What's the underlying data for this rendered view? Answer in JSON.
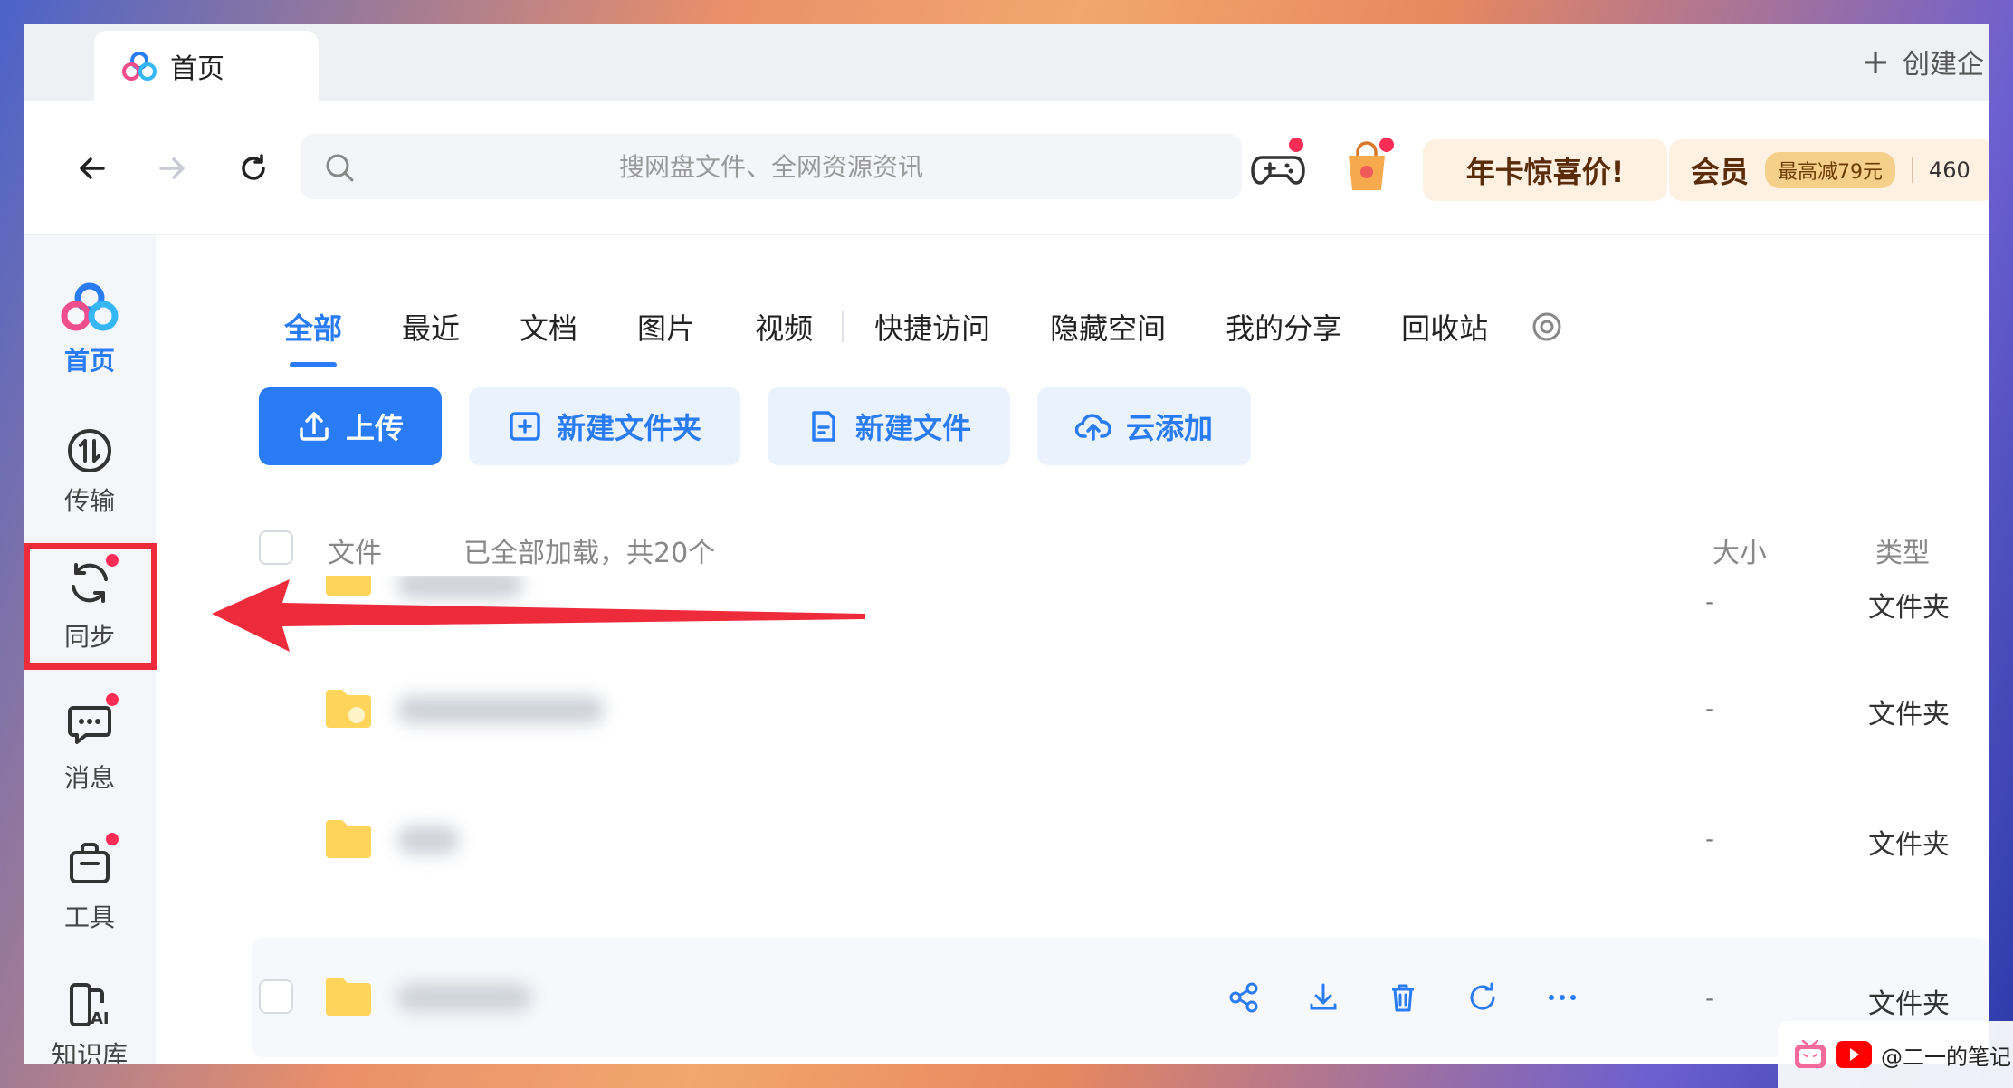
{
  "browser": {
    "tab_title": "首页",
    "new_tab_label": "创建企"
  },
  "toolbar": {
    "search_placeholder": "搜网盘文件、全网资源资讯",
    "promo_annual": "年卡惊喜价!",
    "promo_member": "会员",
    "promo_badge": "最高减79元",
    "promo_extra": "460"
  },
  "sidebar": {
    "items": [
      {
        "label": "首页",
        "icon": "home-logo-icon",
        "active": true
      },
      {
        "label": "传输",
        "icon": "transfer-icon"
      },
      {
        "label": "同步",
        "icon": "sync-icon"
      },
      {
        "label": "消息",
        "icon": "message-icon"
      },
      {
        "label": "工具",
        "icon": "toolbox-icon"
      },
      {
        "label": "知识库",
        "icon": "ai-knowledge-icon"
      }
    ]
  },
  "tabs": [
    "全部",
    "最近",
    "文档",
    "图片",
    "视频",
    "快捷访问",
    "隐藏空间",
    "我的分享",
    "回收站"
  ],
  "actions": {
    "upload": "上传",
    "new_folder": "新建文件夹",
    "new_file": "新建文件",
    "cloud_add": "云添加"
  },
  "list": {
    "header_file": "文件",
    "header_status": "已全部加载，共20个",
    "header_size": "大小",
    "header_type": "类型",
    "rows": [
      {
        "size": "-",
        "type": "文件夹"
      },
      {
        "size": "-",
        "type": "文件夹"
      },
      {
        "size": "-",
        "type": "文件夹"
      },
      {
        "size": "-",
        "type": "文件夹"
      }
    ]
  },
  "watermark": {
    "text": "@二一的笔记"
  },
  "colors": {
    "accent": "#2a7cf6",
    "highlight": "#ee2b3b",
    "notification_dot": "#ff2d55"
  }
}
